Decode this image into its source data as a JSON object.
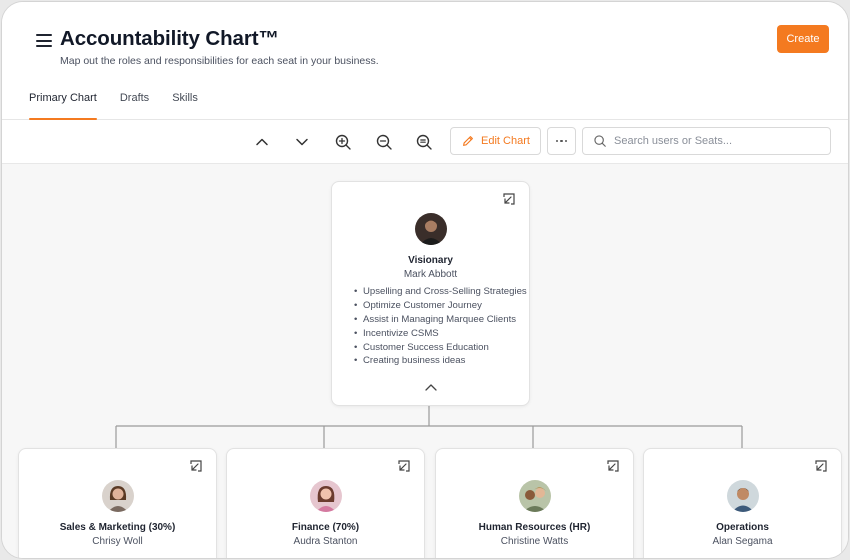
{
  "header": {
    "title": "Accountability Chart™",
    "subtitle": "Map out the roles and responsibilities for each seat in your business.",
    "create_label": "Create",
    "menu_icon": "hamburger-menu-icon"
  },
  "tabs": [
    {
      "label": "Primary Chart",
      "active": true
    },
    {
      "label": "Drafts",
      "active": false
    },
    {
      "label": "Skills",
      "active": false
    }
  ],
  "toolbar": {
    "icons": [
      "chevron-up-icon",
      "chevron-down-icon",
      "zoom-in-icon",
      "zoom-out-icon",
      "zoom-reset-icon"
    ],
    "edit_label": "Edit Chart",
    "more_icon": "ellipsis-icon",
    "search_placeholder": "Search users or Seats..."
  },
  "colors": {
    "accent": "#f47a20",
    "connector": "#9a9a9a",
    "canvas": "#f7f7f7"
  },
  "root_seat": {
    "title": "Visionary",
    "person": "Mark Abbott",
    "responsibilities": [
      "Upselling and Cross-Selling Strategies",
      "Optimize Customer Journey",
      "Assist in Managing Marquee Clients",
      "Incentivize CSMS",
      "Customer Success Education",
      "Creating business ideas"
    ]
  },
  "child_seats": [
    {
      "title": "Sales & Marketing (30%)",
      "person": "Chrisy Woll"
    },
    {
      "title": "Finance (70%)",
      "person": "Audra Stanton"
    },
    {
      "title": "Human Resources (HR)",
      "person": "Christine Watts"
    },
    {
      "title": "Operations",
      "person": "Alan Segama"
    }
  ]
}
